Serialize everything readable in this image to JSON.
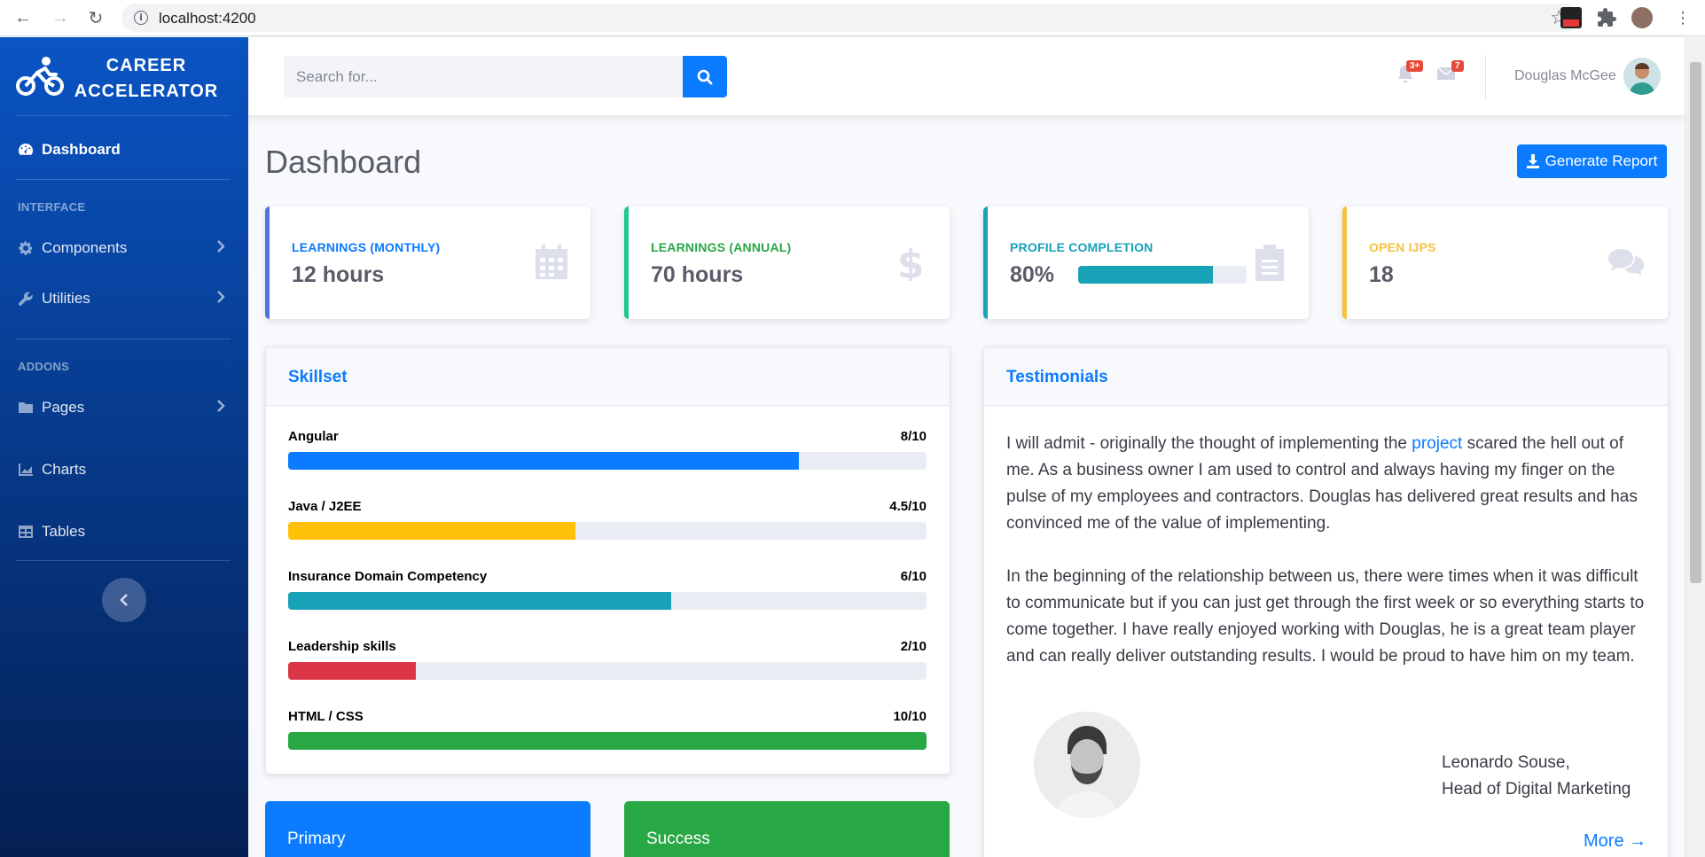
{
  "browser": {
    "url": "localhost:4200"
  },
  "brand": {
    "line1": "CAREER",
    "line2": "ACCELERATOR"
  },
  "sidebar": {
    "dashboard": "Dashboard",
    "section_interface": "INTERFACE",
    "components": "Components",
    "utilities": "Utilities",
    "section_addons": "ADDONS",
    "pages": "Pages",
    "charts": "Charts",
    "tables": "Tables"
  },
  "topbar": {
    "search_placeholder": "Search for...",
    "alerts_badge": "3+",
    "messages_badge": "7",
    "user_name": "Douglas McGee"
  },
  "page": {
    "title": "Dashboard",
    "generate_report": "Generate Report"
  },
  "stats": [
    {
      "label": "LEARNINGS (MONTHLY)",
      "value": "12 hours",
      "color": "#4e73df",
      "icon": "calendar-icon"
    },
    {
      "label": "LEARNINGS (ANNUAL)",
      "value": "70 hours",
      "color": "#1cc88a",
      "icon": "dollar-icon"
    },
    {
      "label": "PROFILE COMPLETION",
      "value": "80%",
      "progress": 0.8,
      "color": "#17a2b8",
      "icon": "clipboard-icon"
    },
    {
      "label": "OPEN IJPS",
      "value": "18",
      "color": "#f6c23e",
      "icon": "comments-icon"
    }
  ],
  "skillset": {
    "title": "Skillset",
    "items": [
      {
        "name": "Angular",
        "score": "8/10",
        "value": 0.8,
        "color": "#0b7bff"
      },
      {
        "name": "Java / J2EE",
        "score": "4.5/10",
        "value": 0.45,
        "color": "#ffc107"
      },
      {
        "name": "Insurance Domain Competency",
        "score": "6/10",
        "value": 0.6,
        "color": "#17a2b8"
      },
      {
        "name": "Leadership skills",
        "score": "2/10",
        "value": 0.2,
        "color": "#dc3545"
      },
      {
        "name": "HTML / CSS",
        "score": "10/10",
        "value": 1.0,
        "color": "#28a745"
      }
    ]
  },
  "testimonials": {
    "title": "Testimonials",
    "p1_before": "I will admit - originally the thought of implementing the ",
    "p1_link": "project",
    "p1_after": " scared the hell out of me. As a business owner I am used to control and always having my finger on the pulse of my employees and contractors. Douglas has delivered great results and has convinced me of the value of implementing.",
    "p2": "In the beginning of the relationship between us, there were times when it was difficult to communicate but if you can just get through the first week or so everything starts to come together. I have really enjoyed working with Douglas, he is a great team player and can really deliver outstanding results. I would be proud to have him on my team.",
    "author_name": "Leonardo Souse,",
    "author_title": "Head of Digital Marketing",
    "more": "More →"
  },
  "color_cards": [
    {
      "label": "Primary",
      "color": "#0b7bff"
    },
    {
      "label": "Success",
      "color": "#28a745"
    }
  ]
}
